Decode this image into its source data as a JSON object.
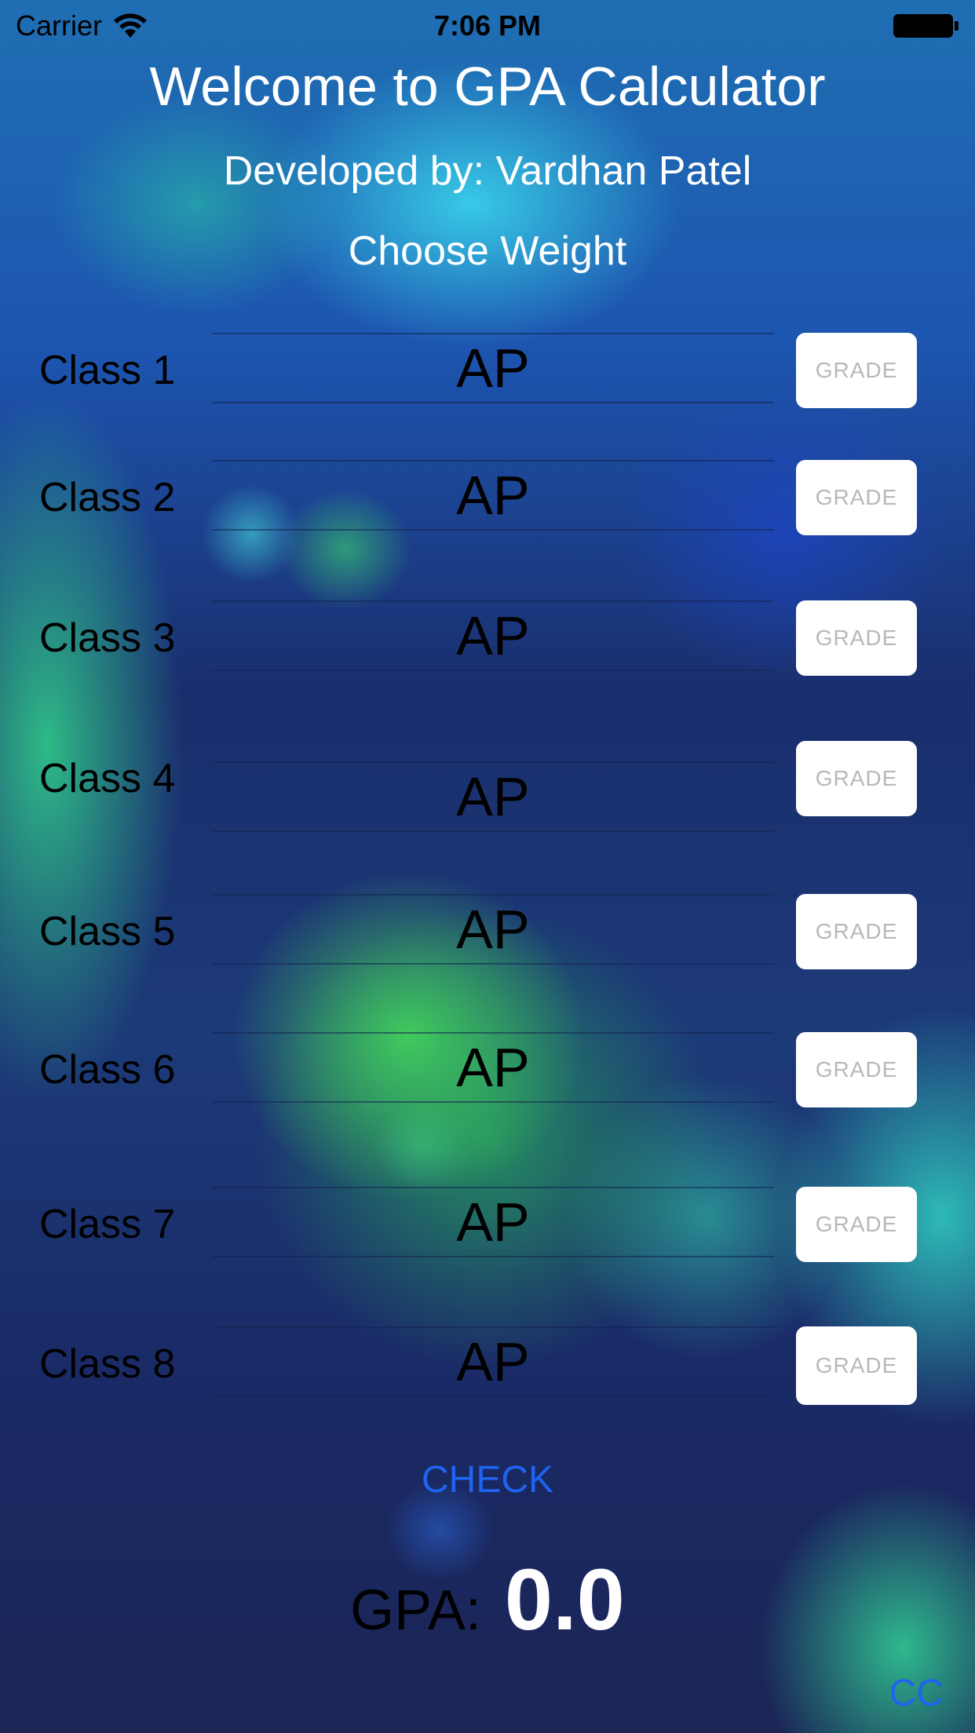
{
  "status_bar": {
    "carrier": "Carrier",
    "time": "7:06 PM",
    "wifi_icon": "wifi-icon",
    "battery_icon": "battery-icon"
  },
  "header": {
    "title": "Welcome to GPA Calculator",
    "subtitle": "Developed by: Vardhan Patel",
    "weight_label": "Choose Weight"
  },
  "classes": [
    {
      "label": "Class 1",
      "weight": "AP",
      "grade_placeholder": "GRADE"
    },
    {
      "label": "Class 2",
      "weight": "AP",
      "grade_placeholder": "GRADE"
    },
    {
      "label": "Class 3",
      "weight": "AP",
      "grade_placeholder": "GRADE"
    },
    {
      "label": "Class 4",
      "weight": "AP",
      "grade_placeholder": "GRADE"
    },
    {
      "label": "Class 5",
      "weight": "AP",
      "grade_placeholder": "GRADE"
    },
    {
      "label": "Class 6",
      "weight": "AP",
      "grade_placeholder": "GRADE"
    },
    {
      "label": "Class 7",
      "weight": "AP",
      "grade_placeholder": "GRADE"
    },
    {
      "label": "Class 8",
      "weight": "AP",
      "grade_placeholder": "GRADE"
    }
  ],
  "actions": {
    "check_label": "CHECK",
    "cc_label": "CC"
  },
  "result": {
    "gpa_label": "GPA:",
    "gpa_value": "0.0"
  },
  "colors": {
    "accent": "#1e64f0",
    "button_bg": "#ffffff",
    "placeholder": "#b8b8b8"
  }
}
